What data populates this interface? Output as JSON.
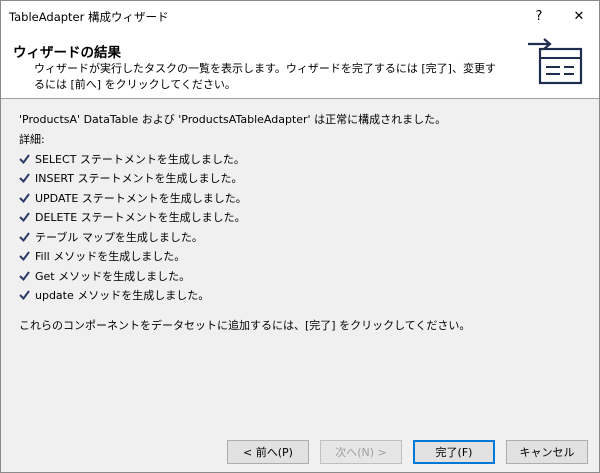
{
  "window": {
    "title": "TableAdapter 構成ウィザード",
    "help_glyph": "?",
    "close_glyph": "✕"
  },
  "header": {
    "title": "ウィザードの結果",
    "description": "ウィザードが実行したタスクの一覧を表示します。ウィザードを完了するには [完了]、変更するには [前へ] をクリックしてください。"
  },
  "main": {
    "summary": "'ProductsA' DataTable および 'ProductsATableAdapter' は正常に構成されました。",
    "details_label": "詳細:",
    "steps": [
      {
        "label": "SELECT ステートメントを生成しました。"
      },
      {
        "label": "INSERT ステートメントを生成しました。"
      },
      {
        "label": "UPDATE ステートメントを生成しました。"
      },
      {
        "label": "DELETE ステートメントを生成しました。"
      },
      {
        "label": "テーブル マップを生成しました。"
      },
      {
        "label": "Fill メソッドを生成しました。"
      },
      {
        "label": "Get メソッドを生成しました。"
      },
      {
        "label": "update メソッドを生成しました。"
      }
    ],
    "footer_text": "これらのコンポーネントをデータセットに追加するには、[完了] をクリックしてください。"
  },
  "buttons": {
    "back": "< 前へ(P)",
    "next": "次へ(N) >",
    "finish": "完了(F)",
    "cancel": "キャンセル"
  },
  "colors": {
    "check": "#2b3a67",
    "accent": "#0078d7"
  },
  "icons": {
    "header": "wizard-arrow-icon",
    "step": "checkmark-icon"
  }
}
